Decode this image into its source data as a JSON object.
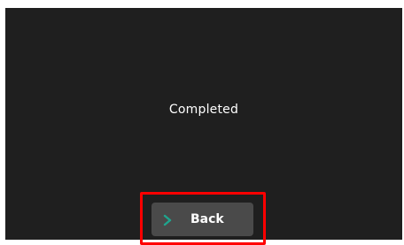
{
  "screen": {
    "status_text": "Completed"
  },
  "back_button": {
    "label": "Back",
    "icon": "chevron-right-icon"
  },
  "colors": {
    "background": "#1f1f1f",
    "button_bg": "#4a4a4a",
    "icon_accent": "#1fa58e",
    "highlight": "#ff0000"
  }
}
